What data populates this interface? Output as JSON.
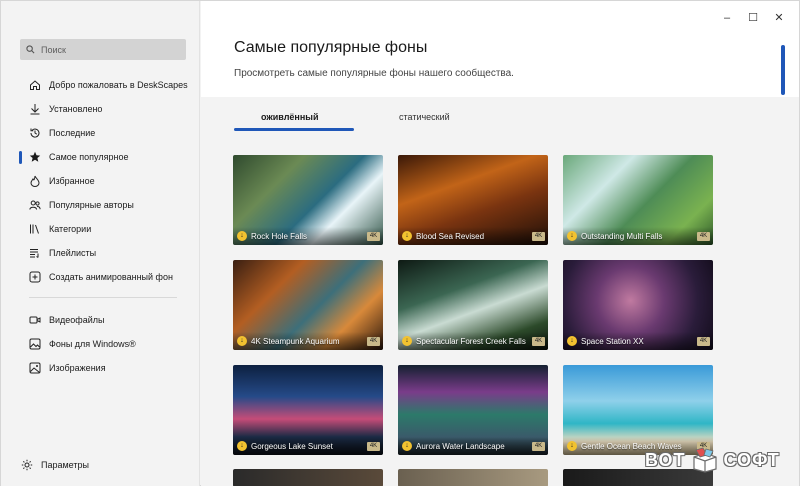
{
  "sidebar": {
    "search_placeholder": "Поиск",
    "items": [
      {
        "label": "Добро пожаловать в DeskScapes",
        "icon": "home-icon"
      },
      {
        "label": "Установлено",
        "icon": "download-arrow-icon"
      },
      {
        "label": "Последние",
        "icon": "history-icon"
      },
      {
        "label": "Самое популярное",
        "icon": "star-icon",
        "active": true
      },
      {
        "label": "Избранное",
        "icon": "flame-icon"
      },
      {
        "label": "Популярные авторы",
        "icon": "people-icon"
      },
      {
        "label": "Категории",
        "icon": "library-icon"
      },
      {
        "label": "Плейлисты",
        "icon": "playlist-icon"
      },
      {
        "label": "Создать анимированный фон",
        "icon": "add-square-icon"
      }
    ],
    "items2": [
      {
        "label": "Видеофайлы",
        "icon": "video-icon"
      },
      {
        "label": "Фоны для Windows®",
        "icon": "image-icon"
      },
      {
        "label": "Изображения",
        "icon": "picture-icon"
      }
    ],
    "settings_label": "Параметры"
  },
  "window_controls": {
    "minimize": "–",
    "maximize": "☐",
    "close": "✕"
  },
  "main": {
    "title": "Самые популярные фоны",
    "subtitle": "Просмотреть самые популярные фоны нашего сообщества.",
    "tabs": [
      "оживлённый",
      "статический"
    ],
    "cards": [
      {
        "title": "Rock Hole Falls",
        "badge": "4K"
      },
      {
        "title": "Blood Sea Revised",
        "badge": "4K"
      },
      {
        "title": "Outstanding Multi Falls",
        "badge": "4K"
      },
      {
        "title": "4K Steampunk Aquarium",
        "badge": "4K"
      },
      {
        "title": "Spectacular Forest Creek Falls",
        "badge": "4K"
      },
      {
        "title": "Space Station XX",
        "badge": "4K"
      },
      {
        "title": "Gorgeous Lake Sunset",
        "badge": "4K"
      },
      {
        "title": "Aurora Water Landscape",
        "badge": "4K"
      },
      {
        "title": "Gentle Ocean Beach Waves",
        "badge": "4K"
      }
    ],
    "accent_color": "#1f57b8"
  },
  "watermark": {
    "left": "ВОТ",
    "right": "СОФТ"
  }
}
